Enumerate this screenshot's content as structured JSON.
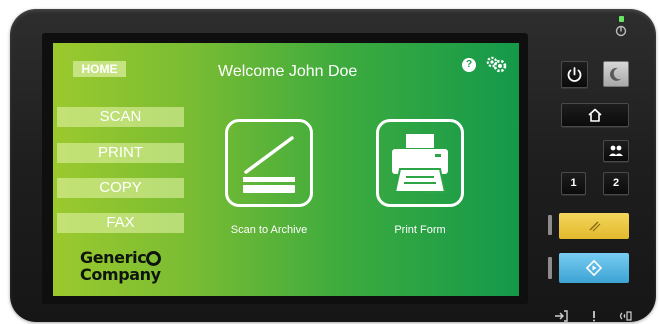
{
  "screen": {
    "home_tab": "HOME",
    "welcome": "Welcome John Doe",
    "help_icon": "?",
    "settings_icon": "gears-icon",
    "menu": [
      "SCAN",
      "PRINT",
      "COPY",
      "FAX"
    ],
    "tiles": [
      {
        "label": "Scan to Archive",
        "icon": "scanner-icon"
      },
      {
        "label": "Print Form",
        "icon": "printer-icon"
      }
    ],
    "logo": {
      "line1": "Generic",
      "line2": "Company"
    }
  },
  "panel": {
    "power_icon": "power-icon",
    "sleep_icon": "moon-icon",
    "home_icon": "home-icon",
    "address_book_icon": "users-icon",
    "number_buttons": [
      "1",
      "2"
    ],
    "stop_icon": "stop-icon",
    "start_icon": "start-icon",
    "bottom_icons": [
      "login-icon",
      "alert-icon",
      "wireless-icon"
    ]
  },
  "colors": {
    "screen_gradient_start": "#9bc92d",
    "screen_gradient_end": "#14994b",
    "stop_button": "#e8c43a",
    "start_button": "#57b7e0",
    "status_led": "#65e665"
  }
}
